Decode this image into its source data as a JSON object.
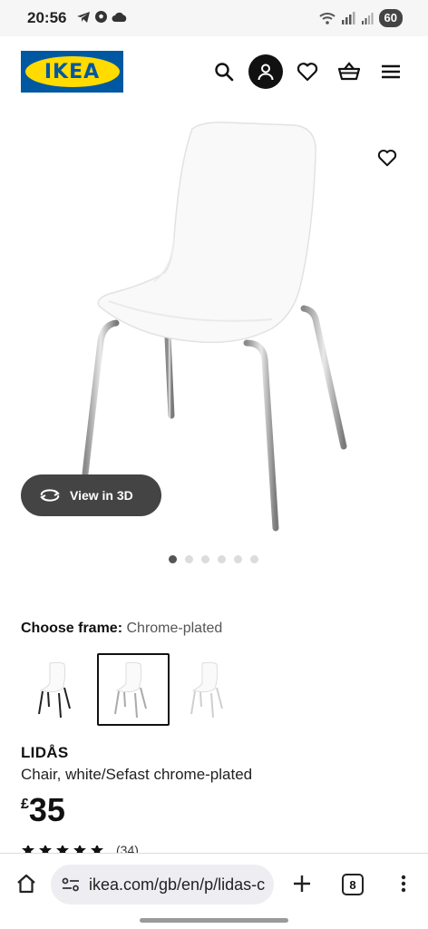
{
  "status_bar": {
    "time": "20:56",
    "battery": "60"
  },
  "header": {
    "logo_text": "IKEA",
    "icons": [
      "search-icon",
      "user-icon",
      "heart-icon",
      "basket-icon",
      "menu-icon"
    ]
  },
  "gallery": {
    "view_3d_label": "View in 3D",
    "dots_total": 6,
    "active_dot": 1
  },
  "frame": {
    "label": "Choose frame:",
    "value": "Chrome-plated",
    "variants": [
      "black",
      "chrome",
      "white"
    ],
    "selected_index": 1
  },
  "product": {
    "name": "LIDÅS",
    "description": "Chair, white/Sefast chrome-plated",
    "currency": "£",
    "price": "35",
    "rating": 5,
    "review_count": "(34)"
  },
  "browser": {
    "url": "ikea.com/gb/en/p/lidas-c",
    "tab_count": "8"
  },
  "colors": {
    "ikea_blue": "#0058a3",
    "ikea_yellow": "#ffdb00",
    "button_dark": "#444444"
  }
}
